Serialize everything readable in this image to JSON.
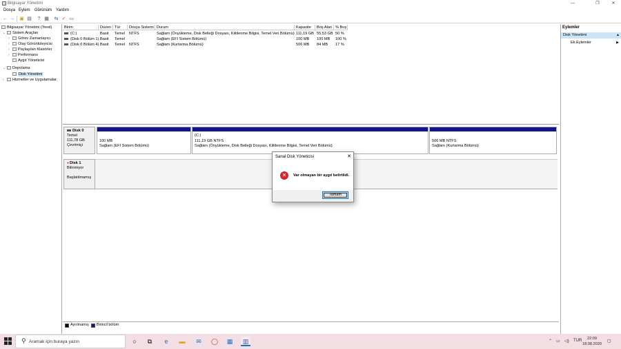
{
  "window": {
    "title": "Bilgisayar Yönetimi",
    "controls": [
      "—",
      "❐",
      "✕"
    ]
  },
  "menu": [
    "Dosya",
    "Eylem",
    "Görünüm",
    "Yardım"
  ],
  "tree": [
    {
      "label": "Bilgisayar Yönetimi (Yerel)",
      "expander": "",
      "level": 0
    },
    {
      "label": "Sistem Araçları",
      "expander": "⌄",
      "level": 1
    },
    {
      "label": "Görev Zamanlayıcı",
      "expander": "›",
      "level": 2
    },
    {
      "label": "Olay Görüntüleyicisi",
      "expander": "›",
      "level": 2
    },
    {
      "label": "Paylaşılan Klasörler",
      "expander": "›",
      "level": 2
    },
    {
      "label": "Performans",
      "expander": "›",
      "level": 2
    },
    {
      "label": "Aygıt Yöneticisi",
      "expander": "",
      "level": 2
    },
    {
      "label": "Depolama",
      "expander": "⌄",
      "level": 1
    },
    {
      "label": "Disk Yönetimi",
      "expander": "",
      "level": 2,
      "selected": true
    },
    {
      "label": "Hizmetler ve Uygulamalar",
      "expander": "›",
      "level": 1
    }
  ],
  "volumes": {
    "columns": [
      "Birim",
      "Düzen",
      "Tür",
      "Dosya Sistemi",
      "Durum",
      "Kapasite",
      "Boş Alan",
      "% Boş"
    ],
    "rows": [
      [
        "(C:)",
        "Basit",
        "Temel",
        "NTFS",
        "Sağlam (Önyükleme, Disk Belleği Dosyası, Kilitlenme Bilgisi, Temel Veri Bölümü)",
        "111,19 GB",
        "55,53 GB",
        "50 %"
      ],
      [
        "(Disk 0 Bölüm 1)",
        "Basit",
        "Temel",
        "",
        "Sağlam (EFI Sistem Bölümü)",
        "100 MB",
        "100 MB",
        "100 %"
      ],
      [
        "(Disk 0 Bölüm 4)",
        "Basit",
        "Temel",
        "NTFS",
        "Sağlam (Kurtarma Bölümü)",
        "506 MB",
        "84 MB",
        "17 %"
      ]
    ]
  },
  "disks": [
    {
      "name": "Disk 0",
      "type": "Temel",
      "size": "111,78 GB",
      "state": "Çevrimiçi",
      "partitions": [
        {
          "title": "",
          "size": "100 MB",
          "status": "Sağlam (EFI Sistem Bölümü)"
        },
        {
          "title": "(C:)",
          "size": "111,19 GB NTFS",
          "status": "Sağlam (Önyükleme, Disk Belleği Dosyası, Kilitlenme Bilgisi, Temel Veri Bölümü)"
        },
        {
          "title": "",
          "size": "506 MB NTFS",
          "status": "Sağlam (Kurtarma Bölümü)"
        }
      ]
    },
    {
      "name": "Disk 1",
      "type": "Bilinmiyor",
      "size": "",
      "state": "Başlatılmamış"
    }
  ],
  "legend": {
    "unallocated": "Ayrılmamış",
    "primary": "Birincil bölüm"
  },
  "actions": {
    "header": "Eylemler",
    "selected": "Disk Yönetimi",
    "item": "Ek Eylemler"
  },
  "dialog": {
    "title": "Sanal Disk Yöneticisi",
    "message": "Var olmayan bir aygıt belirtildi.",
    "ok": "Tamam"
  },
  "taskbar": {
    "search_placeholder": "Aramak için buraya yazın",
    "lang": "TUR",
    "time": "22:09",
    "date": "18.08.2020"
  },
  "colors": {
    "primary_partition": "#14148c",
    "taskbar": "#f3dfe3",
    "selection": "#cce4f7",
    "error": "#d4232b"
  }
}
